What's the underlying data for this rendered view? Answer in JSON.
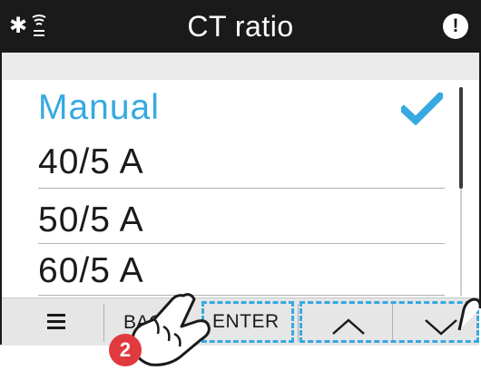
{
  "status_bar": {
    "bluetooth_icon": "bluetooth-icon",
    "wireless_icon": "wireless-icon",
    "title": "CT ratio",
    "warning_icon": "warning-icon",
    "warning_glyph": "!"
  },
  "list": {
    "items": [
      {
        "label": "Manual",
        "selected": true
      },
      {
        "label": "40/5 A",
        "selected": false
      },
      {
        "label": "50/5 A",
        "selected": false
      },
      {
        "label": "60/5 A",
        "selected": false
      }
    ],
    "check_icon": "checkmark-icon"
  },
  "softkeys": {
    "menu_icon": "menu-icon",
    "back_label": "BACK",
    "enter_label": "ENTER",
    "up_icon": "chevron-up-icon",
    "down_icon": "chevron-down-icon"
  },
  "annotation": {
    "step_number": "2",
    "hand_icon": "pointing-hand-icon"
  },
  "colors": {
    "accent": "#36a9e1",
    "status_bar": "#1a1a1a",
    "step_badge": "#e03a3e"
  }
}
